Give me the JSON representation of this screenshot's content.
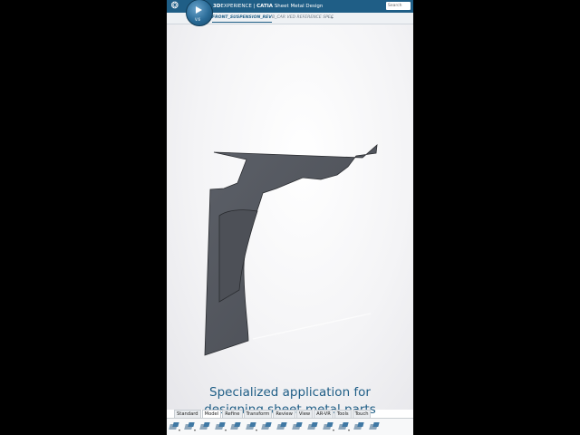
{
  "header": {
    "brand_bold": "3D",
    "brand_rest": "EXPERIENCE | ",
    "app_bold": "CATIA",
    "app_name": "Sheet Metal Design",
    "search_placeholder": "Search"
  },
  "tabs": {
    "active": "FRONT_SUSPENSION_REV",
    "inactive": "B_CAR VED REFERENCE SPEC",
    "plus": "+"
  },
  "compass": {
    "tag": "V.6"
  },
  "caption": {
    "line1": "Specialized application for",
    "line2": "designing sheet metal parts"
  },
  "toolbar": {
    "tabs": [
      "Standard",
      "Model",
      "Refine",
      "Transform",
      "Review",
      "View",
      "AR-VR",
      "Tools",
      "Touch"
    ],
    "active_tab": "Model"
  },
  "colors": {
    "topbar": "#1f5e86",
    "caption": "#1f5e86",
    "part_fill": "#545860"
  }
}
